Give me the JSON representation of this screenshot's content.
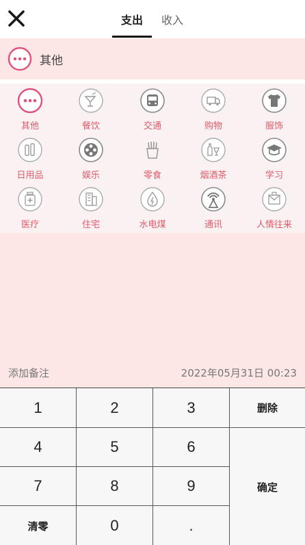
{
  "header": {
    "close_icon": "close-icon",
    "tabs": [
      {
        "label": "支出",
        "active": true
      },
      {
        "label": "收入",
        "active": false
      }
    ]
  },
  "selected": {
    "icon": "more-dots-icon",
    "label": "其他"
  },
  "categories": [
    {
      "label": "其他",
      "icon": "more-dots-icon",
      "selected": true
    },
    {
      "label": "餐饮",
      "icon": "cocktail-icon"
    },
    {
      "label": "交通",
      "icon": "bus-icon"
    },
    {
      "label": "购物",
      "icon": "delivery-truck-icon"
    },
    {
      "label": "服饰",
      "icon": "tshirt-icon"
    },
    {
      "label": "日用品",
      "icon": "toiletries-icon"
    },
    {
      "label": "娱乐",
      "icon": "film-reel-icon"
    },
    {
      "label": "零食",
      "icon": "fries-icon"
    },
    {
      "label": "烟酒茶",
      "icon": "bottle-glass-icon"
    },
    {
      "label": "学习",
      "icon": "graduation-cap-icon"
    },
    {
      "label": "医疗",
      "icon": "medicine-bottle-icon"
    },
    {
      "label": "住宅",
      "icon": "building-icon"
    },
    {
      "label": "水电煤",
      "icon": "water-drop-icon"
    },
    {
      "label": "通讯",
      "icon": "signal-tower-icon"
    },
    {
      "label": "人情往来",
      "icon": "gift-envelope-icon"
    }
  ],
  "memo": {
    "label": "添加备注",
    "date": "2022年05月31日 00:23"
  },
  "keypad": {
    "keys": [
      "1",
      "2",
      "3",
      "4",
      "5",
      "6",
      "7",
      "8",
      "9",
      "清零",
      "0",
      "."
    ],
    "delete_label": "删除",
    "confirm_label": "确定"
  },
  "colors": {
    "accent": "#e05a6a",
    "selected_bg": "#fde6e6",
    "grid_bg": "#faf2f2",
    "icon_gray": "#999999"
  }
}
